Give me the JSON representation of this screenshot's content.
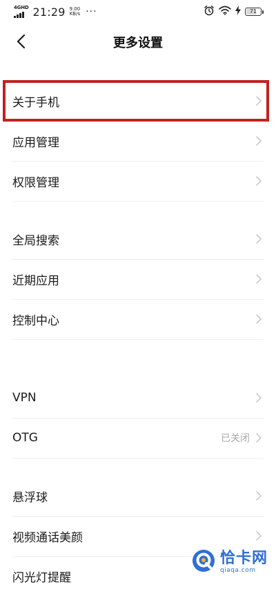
{
  "status_bar": {
    "network": "4G",
    "network_sup": "HD",
    "time": "21:29",
    "speed_value": "9.00",
    "speed_unit": "KB/s",
    "more": "···",
    "battery": "71",
    "battery_level": 0.71
  },
  "header": {
    "title": "更多设置"
  },
  "items": {
    "about_phone": "关于手机",
    "app_management": "应用管理",
    "permission_management": "权限管理",
    "global_search": "全局搜索",
    "recent_apps": "近期应用",
    "control_center": "控制中心",
    "vpn": "VPN",
    "otg": "OTG",
    "otg_status": "已关闭",
    "floating_ball": "悬浮球",
    "video_call_beauty": "视频通话美颜",
    "flash_reminder": "闪光灯提醒"
  },
  "watermark": {
    "name": "恰卡网",
    "url": "qiaqa.com"
  },
  "colors": {
    "highlight": "#c0221e",
    "chevron": "#c4c4c4",
    "watermark": "#2f6fd6"
  }
}
